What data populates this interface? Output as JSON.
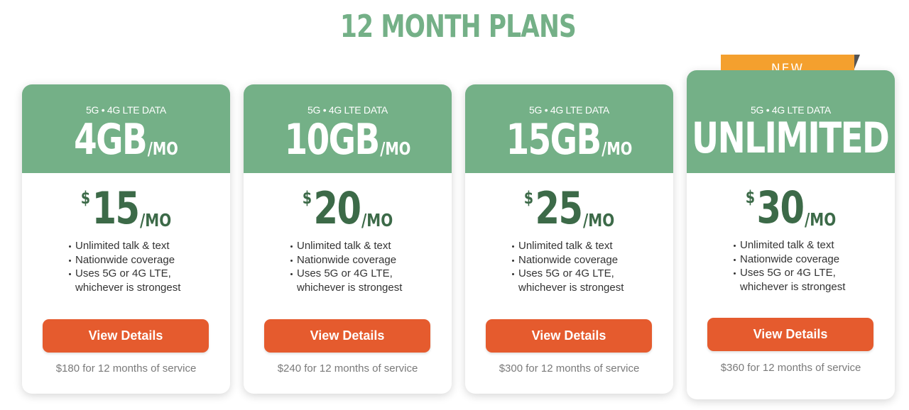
{
  "page": {
    "title": "12 MONTH PLANS"
  },
  "plans": [
    {
      "data_type": "5G • 4G LTE DATA",
      "data_amount": "4GB",
      "data_unit": "/MO",
      "currency": "$",
      "price": "15",
      "price_unit": "/MO",
      "features": [
        "Unlimited talk & text",
        "Nationwide coverage",
        "Uses 5G or 4G LTE,\nwhichever is strongest"
      ],
      "button_label": "View Details",
      "service_note": "$180 for 12 months of service"
    },
    {
      "data_type": "5G • 4G LTE DATA",
      "data_amount": "10GB",
      "data_unit": "/MO",
      "currency": "$",
      "price": "20",
      "price_unit": "/MO",
      "features": [
        "Unlimited talk & text",
        "Nationwide coverage",
        "Uses 5G or 4G LTE,\nwhichever is strongest"
      ],
      "button_label": "View Details",
      "service_note": "$240 for 12 months of service"
    },
    {
      "data_type": "5G • 4G LTE DATA",
      "data_amount": "15GB",
      "data_unit": "/MO",
      "currency": "$",
      "price": "25",
      "price_unit": "/MO",
      "features": [
        "Unlimited talk & text",
        "Nationwide coverage",
        "Uses 5G or 4G LTE,\nwhichever is strongest"
      ],
      "button_label": "View Details",
      "service_note": "$300 for 12 months of service"
    },
    {
      "badge": "NEW",
      "data_type": "5G • 4G LTE DATA",
      "data_amount": "UNLIMITED",
      "data_unit": "",
      "currency": "$",
      "price": "30",
      "price_unit": "/MO",
      "features": [
        "Unlimited talk & text",
        "Nationwide coverage",
        "Uses 5G or 4G LTE,\nwhichever is strongest"
      ],
      "button_label": "View Details",
      "service_note": "$360 for 12 months of service"
    }
  ],
  "colors": {
    "header_green": "#74b087",
    "price_green": "#3c6a48",
    "button_orange": "#e55b2e",
    "badge_orange": "#f4a02e"
  }
}
